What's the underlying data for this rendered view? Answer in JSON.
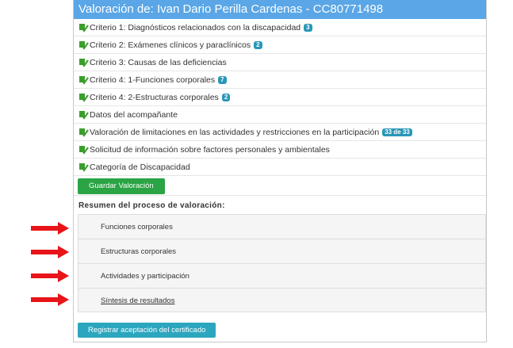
{
  "header": {
    "title": "Valoración de: Ivan Dario Perilla Cardenas - CC80771498"
  },
  "criteria": [
    {
      "label": "Criterio 1: Diagnósticos relacionados con la discapacidad",
      "badge": "3"
    },
    {
      "label": "Criterio 2: Exámenes clínicos y paraclínicos",
      "badge": "2"
    },
    {
      "label": "Criterio 3: Causas de las deficiencias",
      "badge": null
    },
    {
      "label": "Criterio 4: 1-Funciones corporales",
      "badge": "7"
    },
    {
      "label": "Criterio 4: 2-Estructuras corporales",
      "badge": "2"
    },
    {
      "label": "Datos del acompañante",
      "badge": null
    },
    {
      "label": "Valoración de limitaciones en las actividades y restricciones en la participación",
      "badge": "33 de 33"
    },
    {
      "label": "Solicitud de información sobre factores personales y ambientales",
      "badge": null
    },
    {
      "label": "Categoría de Discapacidad",
      "badge": null
    }
  ],
  "buttons": {
    "save": "Guardar Valoración",
    "certificate": "Registrar aceptación del certificado"
  },
  "summary": {
    "title": "Resumen del proceso de valoración:",
    "items": [
      {
        "label": "Funciones corporales"
      },
      {
        "label": "Estructuras corporales"
      },
      {
        "label": "Actividades y participación"
      },
      {
        "label": "Síntesis de resultados"
      }
    ]
  },
  "colors": {
    "header_bg": "#5aa6e6",
    "badge_bg": "#2b97b8",
    "save_button": "#2aa444",
    "certificate_button": "#2ba6bf",
    "arrow": "#e8141a",
    "check_icon": "#3a9e2c"
  },
  "icons": {
    "criterion": "check-document-icon",
    "pointer": "red-arrow-icon"
  }
}
